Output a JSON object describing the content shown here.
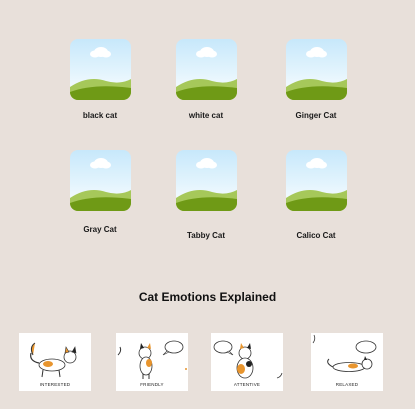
{
  "cats": [
    {
      "label": "black cat",
      "icon": "landscape-placeholder-icon"
    },
    {
      "label": "white cat",
      "icon": "landscape-placeholder-icon"
    },
    {
      "label": "Ginger Cat",
      "icon": "landscape-placeholder-icon"
    },
    {
      "label": "Gray Cat",
      "icon": "landscape-placeholder-icon"
    },
    {
      "label": "Tabby Cat",
      "icon": "landscape-placeholder-icon"
    },
    {
      "label": "Calico Cat",
      "icon": "landscape-placeholder-icon"
    }
  ],
  "section_title": "Cat Emotions Explained",
  "emotions": [
    {
      "caption": "INTERESTED"
    },
    {
      "caption": "FRIENDLY"
    },
    {
      "caption": "ATTENTIVE"
    },
    {
      "caption": "RELAXED"
    }
  ],
  "colors": {
    "background": "#e8e0da",
    "sky": "#c7e8fb",
    "hill_light": "#a6c85a",
    "hill_dark": "#6f9a16",
    "calico_orange": "#e8952e"
  }
}
